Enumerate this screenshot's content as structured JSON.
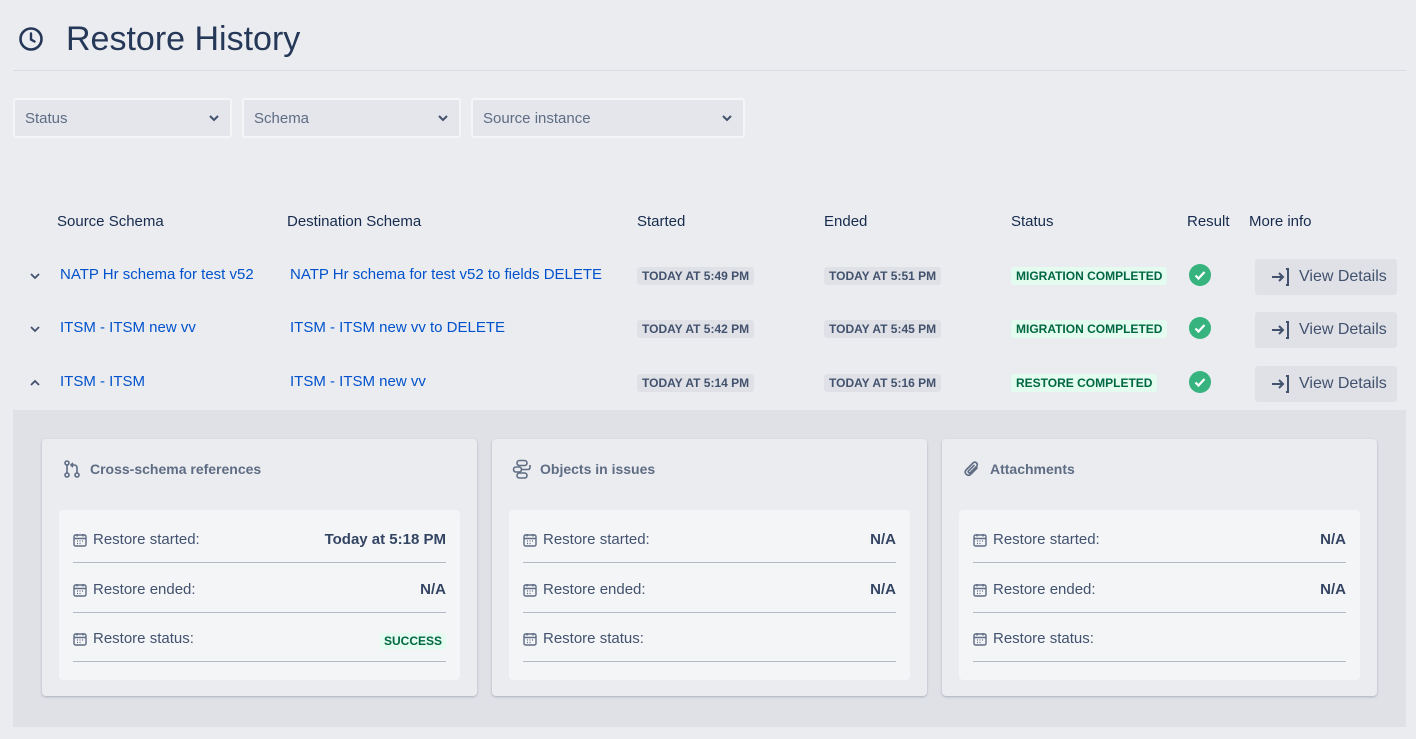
{
  "page": {
    "title": "Restore History"
  },
  "filters": [
    {
      "label": "Status"
    },
    {
      "label": "Schema"
    },
    {
      "label": "Source instance"
    }
  ],
  "table": {
    "headers": {
      "source": "Source Schema",
      "destination": "Destination Schema",
      "started": "Started",
      "ended": "Ended",
      "status": "Status",
      "result": "Result",
      "more": "More info"
    },
    "rows": [
      {
        "source": "NATP Hr schema for test v52",
        "destination": "NATP Hr schema for test v52 to fields DELETE",
        "started": "TODAY AT 5:49 PM",
        "ended": "TODAY AT 5:51 PM",
        "status": "MIGRATION COMPLETED",
        "expanded": false,
        "button": "View Details"
      },
      {
        "source": "ITSM - ITSM new vv",
        "destination": "ITSM - ITSM new vv to DELETE",
        "started": "TODAY AT 5:42 PM",
        "ended": "TODAY AT 5:45 PM",
        "status": "MIGRATION COMPLETED",
        "expanded": false,
        "button": "View Details"
      },
      {
        "source": "ITSM - ITSM",
        "destination": "ITSM - ITSM new vv",
        "started": "TODAY AT 5:14 PM",
        "ended": "TODAY AT 5:16 PM",
        "status": "RESTORE COMPLETED",
        "expanded": true,
        "button": "View Details"
      }
    ]
  },
  "details": {
    "cards": [
      {
        "title": "Cross-schema references",
        "icon": "branch-icon",
        "started_label": "Restore started:",
        "started_value": "Today at 5:18 PM",
        "ended_label": "Restore ended:",
        "ended_value": "N/A",
        "status_label": "Restore status:",
        "status_value": "SUCCESS"
      },
      {
        "title": "Objects in issues",
        "icon": "objects-icon",
        "started_label": "Restore started:",
        "started_value": "N/A",
        "ended_label": "Restore ended:",
        "ended_value": "N/A",
        "status_label": "Restore status:",
        "status_value": ""
      },
      {
        "title": "Attachments",
        "icon": "paperclip-icon",
        "started_label": "Restore started:",
        "started_value": "N/A",
        "ended_label": "Restore ended:",
        "ended_value": "N/A",
        "status_label": "Restore status:",
        "status_value": ""
      }
    ]
  },
  "colors": {
    "link": "#0052cc",
    "success_bg": "#e3fcef",
    "success_text": "#006644",
    "check_green": "#36b37e"
  }
}
